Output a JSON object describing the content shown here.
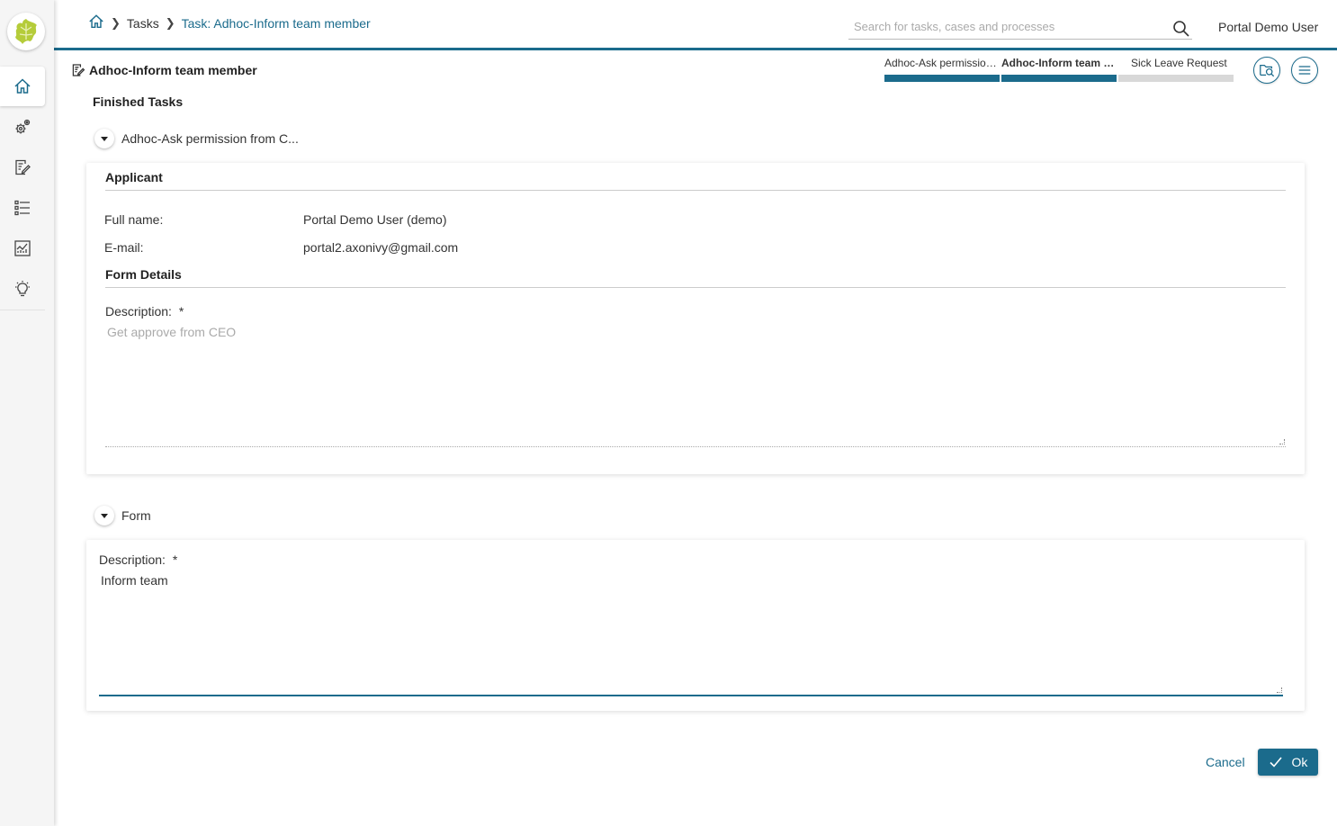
{
  "app": {
    "logo_icon": "ivy-leaf-logo",
    "accent_color": "#1b6b8c"
  },
  "sidebar": {
    "items": [
      {
        "icon": "home-icon",
        "active": true
      },
      {
        "icon": "process-gears-icon",
        "active": false
      },
      {
        "icon": "task-edit-icon",
        "active": false
      },
      {
        "icon": "case-list-icon",
        "active": false
      },
      {
        "icon": "statistics-icon",
        "active": false
      },
      {
        "icon": "lightbulb-icon",
        "active": false
      }
    ]
  },
  "header": {
    "breadcrumb": {
      "home_icon": "home-icon",
      "tasks": "Tasks",
      "current": "Task: Adhoc-Inform team member"
    },
    "search": {
      "placeholder": "Search for tasks, cases and processes"
    },
    "user_name": "Portal Demo User"
  },
  "task": {
    "title": "Adhoc-Inform team member",
    "steps": [
      {
        "label": "Adhoc-Ask permission from CEO",
        "state": "done"
      },
      {
        "label": "Adhoc-Inform team member",
        "state": "current"
      },
      {
        "label": "Sick Leave Request",
        "state": "todo"
      }
    ],
    "actions": {
      "case_details_icon": "case-details-icon",
      "menu_icon": "menu-icon"
    }
  },
  "finished_tasks": {
    "title": "Finished Tasks",
    "item_label": "Adhoc-Ask permission from C...",
    "applicant": {
      "title": "Applicant",
      "full_name_label": "Full name:",
      "full_name_value": "Portal Demo User (demo)",
      "email_label": "E-mail:",
      "email_value": "portal2.axonivy@gmail.com"
    },
    "form_details": {
      "title": "Form Details",
      "description_label": "Description:",
      "required_mark": "*",
      "description_value": "Get approve from CEO"
    }
  },
  "form": {
    "toggle_label": "Form",
    "description_label": "Description:",
    "required_mark": "*",
    "description_value": "Inform team"
  },
  "footer": {
    "cancel_label": "Cancel",
    "ok_label": "Ok"
  }
}
